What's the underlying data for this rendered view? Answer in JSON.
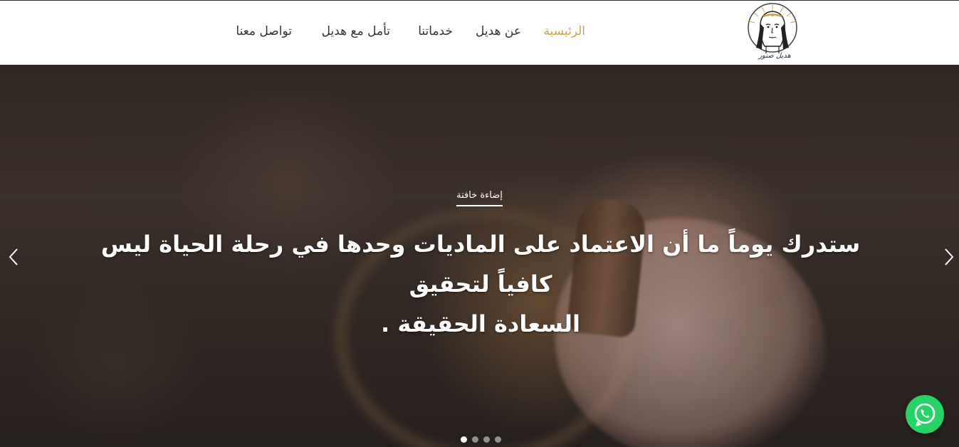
{
  "header": {
    "logo_signature": "هديل صنور",
    "nav": [
      {
        "label": "الرئيسية",
        "active": true
      },
      {
        "label": "عن هديل",
        "active": false
      },
      {
        "label": "خدماتنا",
        "active": false
      },
      {
        "label": "تأمل مع هديل",
        "active": false
      },
      {
        "label": "تواصل معنا",
        "active": false
      }
    ]
  },
  "hero": {
    "eyebrow": "إضاءة خافتة",
    "headline_line1": "ستدرك يوماً ما أن الاعتماد على الماديات وحدها في رحلة الحياة ليس كافياً لتحقيق",
    "headline_line2": "السعادة الحقيقة .",
    "slides_count": 4,
    "active_slide": 1,
    "prev_icon": "chevron-left-icon",
    "next_icon": "chevron-right-icon"
  },
  "floating": {
    "whatsapp_icon": "whatsapp-icon"
  },
  "colors": {
    "accent": "#c9a44c",
    "nav_text": "#333333",
    "whatsapp": "#25d366"
  }
}
